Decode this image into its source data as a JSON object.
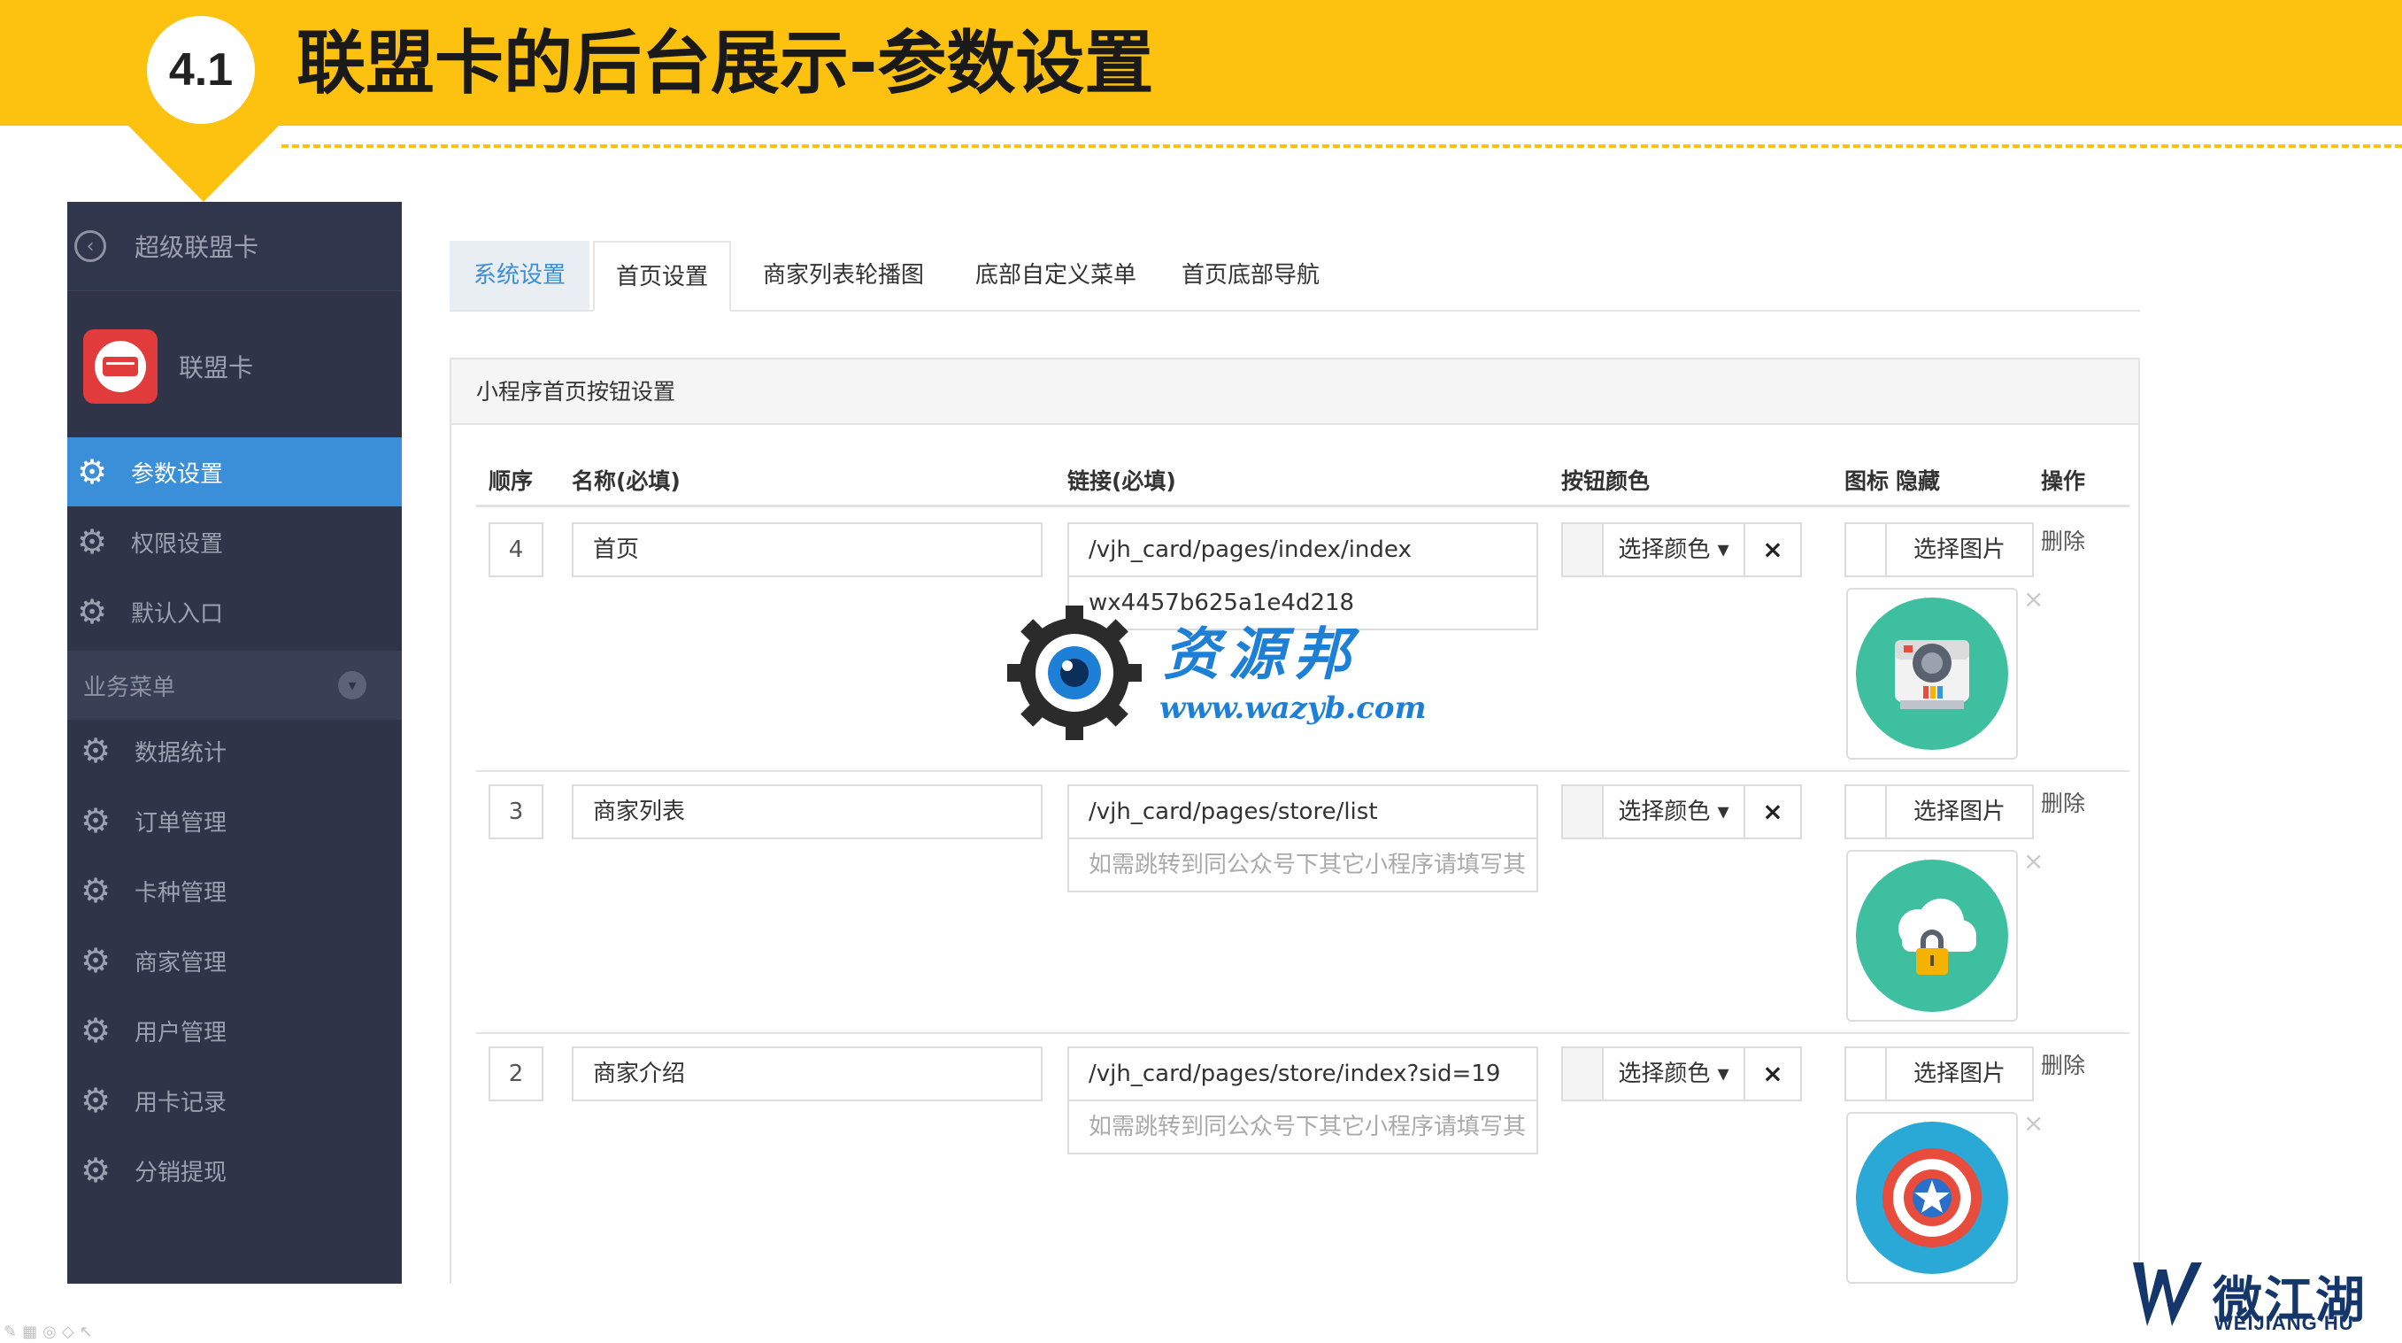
{
  "slide": {
    "section_number": "4.1",
    "title": "联盟卡的后台展示-参数设置",
    "accent_color": "#fdc10f"
  },
  "sidebar": {
    "back_label": "超级联盟卡",
    "app_label": "联盟卡",
    "items_top": [
      {
        "label": "参数设置",
        "icon": "gear-icon",
        "active": true
      },
      {
        "label": "权限设置",
        "icon": "gear-icon",
        "active": false
      },
      {
        "label": "默认入口",
        "icon": "gear-icon",
        "active": false
      }
    ],
    "section_label": "业务菜单",
    "items_business": [
      {
        "label": "数据统计",
        "icon": "gear-icon"
      },
      {
        "label": "订单管理",
        "icon": "gear-icon"
      },
      {
        "label": "卡种管理",
        "icon": "gear-icon"
      },
      {
        "label": "商家管理",
        "icon": "gear-icon"
      },
      {
        "label": "用户管理",
        "icon": "gear-icon"
      },
      {
        "label": "用卡记录",
        "icon": "gear-icon"
      },
      {
        "label": "分销提现",
        "icon": "gear-icon"
      }
    ],
    "active_color": "#3b8fd9"
  },
  "tabs": [
    "系统设置",
    "首页设置",
    "商家列表轮播图",
    "底部自定义菜单",
    "首页底部导航"
  ],
  "panel": {
    "title": "小程序首页按钮设置",
    "headers": {
      "order": "顺序",
      "name": "名称(必填)",
      "link": "链接(必填)",
      "color": "按钮颜色",
      "icon": "图标",
      "hide": "隐藏",
      "action": "操作"
    },
    "rows": [
      {
        "order": "4",
        "name": "首页",
        "link": "/vjh_card/pages/index/index",
        "appid": "wx4457b625a1e4d218",
        "appid_filled": true,
        "color_button": "选择颜色",
        "clear_symbol": "×",
        "image_button": "选择图片",
        "delete_label": "删除",
        "icon": "camera-icon"
      },
      {
        "order": "3",
        "name": "商家列表",
        "link": "/vjh_card/pages/store/list",
        "appid": "如需跳转到同公众号下其它小程序请填写其",
        "appid_filled": false,
        "color_button": "选择颜色",
        "clear_symbol": "×",
        "image_button": "选择图片",
        "delete_label": "删除",
        "icon": "cloud-lock-icon"
      },
      {
        "order": "2",
        "name": "商家介绍",
        "link": "/vjh_card/pages/store/index?sid=19",
        "appid": "如需跳转到同公众号下其它小程序请填写其",
        "appid_filled": false,
        "color_button": "选择颜色",
        "clear_symbol": "×",
        "image_button": "选择图片",
        "delete_label": "删除",
        "icon": "shield-star-icon"
      }
    ]
  },
  "watermark": {
    "text": "资源邦",
    "url": "www.wazyb.com"
  },
  "brand": {
    "name_cn": "微江湖",
    "name_en": "WEIJIANG HU"
  }
}
